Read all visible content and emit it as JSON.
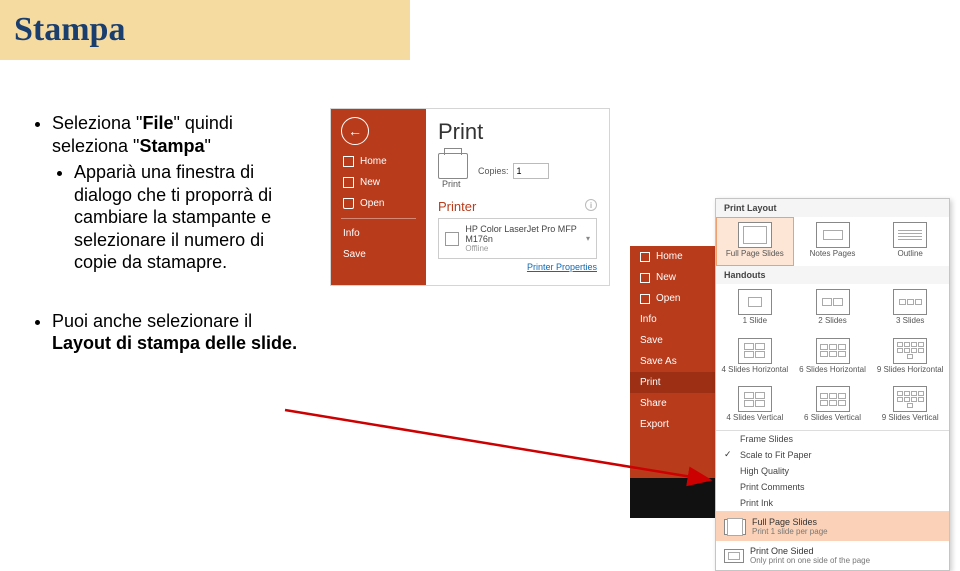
{
  "slide": {
    "title": "Stampa",
    "bullet1_pre": "Seleziona \"",
    "bullet1_b1": "File",
    "bullet1_mid": "\" quindi seleziona \"",
    "bullet1_b2": "Stampa",
    "bullet1_post": "\"",
    "sub1": "Apparià una finestra di dialogo che ti proporrà di cambiare la stampante e selezionare il numero di copie da stamapre.",
    "bullet2_pre": "Puoi anche selezionare il ",
    "bullet2_b": "Layout di stampa delle slide.",
    "bullet2_post": ""
  },
  "shot1": {
    "nav_home": "Home",
    "nav_new": "New",
    "nav_open": "Open",
    "nav_info": "Info",
    "nav_save": "Save",
    "title": "Print",
    "copies_label": "Copies:",
    "copies_value": "1",
    "print_label": "Print",
    "printer_sec": "Printer",
    "printer_name": "HP Color LaserJet Pro MFP M176n",
    "printer_status": "Offline",
    "printer_props": "Printer Properties"
  },
  "shot2": {
    "nav": [
      "Home",
      "New",
      "Open",
      "Info",
      "Save",
      "Save As",
      "Print",
      "Share",
      "Export"
    ],
    "nav_sel_index": 6,
    "hdr1": "Print Layout",
    "row1": [
      {
        "label": "Full Page Slides",
        "sel": true,
        "t": "one"
      },
      {
        "label": "Notes Pages",
        "t": "notes"
      },
      {
        "label": "Outline",
        "t": "lines"
      }
    ],
    "hdr2": "Handouts",
    "row2": [
      {
        "label": "1 Slide",
        "t": "g1"
      },
      {
        "label": "2 Slides",
        "t": "g2"
      },
      {
        "label": "3 Slides",
        "t": "g3"
      }
    ],
    "row3": [
      {
        "label": "4 Slides Horizontal",
        "t": "g4"
      },
      {
        "label": "6 Slides Horizontal",
        "t": "g6"
      },
      {
        "label": "9 Slides Horizontal",
        "t": "g9"
      }
    ],
    "row4": [
      {
        "label": "4 Slides Vertical",
        "t": "g4"
      },
      {
        "label": "6 Slides Vertical",
        "t": "g6"
      },
      {
        "label": "9 Slides Vertical",
        "t": "g9"
      }
    ],
    "opts": [
      {
        "label": "Frame Slides",
        "chk": false
      },
      {
        "label": "Scale to Fit Paper",
        "chk": true
      },
      {
        "label": "High Quality",
        "chk": false
      },
      {
        "label": "Print Comments",
        "chk": false
      },
      {
        "label": "Print Ink",
        "chk": false
      }
    ],
    "sel1_t": "Full Page Slides",
    "sel1_s": "Print 1 slide per page",
    "sel2_t": "Print One Sided",
    "sel2_s": "Only print on one side of the page"
  }
}
